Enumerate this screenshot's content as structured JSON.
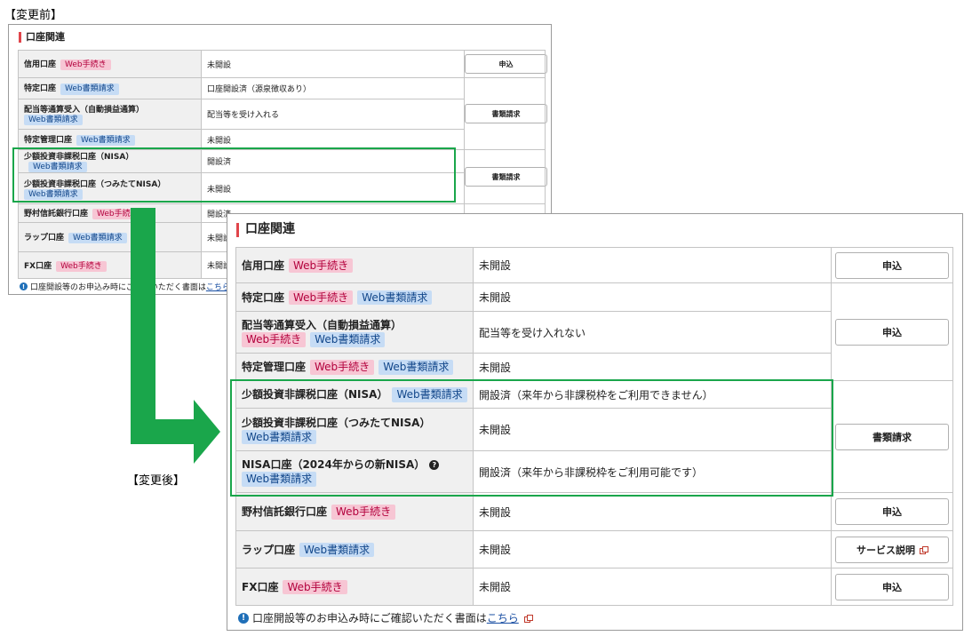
{
  "labels": {
    "before": "【変更前】",
    "after": "【変更後】"
  },
  "tags": {
    "web": "Web手続き",
    "doc": "Web書類請求"
  },
  "before": {
    "title": "口座関連",
    "rows": [
      {
        "label": "信用口座",
        "value": "未開設"
      },
      {
        "label": "特定口座",
        "value": "口座開設済（源泉徴収あり）"
      },
      {
        "label": "配当等通算受入（自動損益通算）",
        "value": "配当等を受け入れる"
      },
      {
        "label": "特定管理口座",
        "value": "未開設"
      },
      {
        "label": "少額投資非課税口座（NISA）",
        "value": "開設済"
      },
      {
        "label": "少額投資非課税口座（つみたてNISA）",
        "value": "未開設"
      },
      {
        "label": "野村信託銀行口座",
        "value": "開設済"
      },
      {
        "label": "ラップ口座",
        "value": "未開設"
      },
      {
        "label": "FX口座",
        "value": "未開設"
      }
    ],
    "buttons": {
      "apply": "申込",
      "docs": "書類請求"
    },
    "note": {
      "text": "口座開設等のお申込み時にご確認いただく書面は",
      "link": "こちら"
    }
  },
  "after": {
    "title": "口座関連",
    "rows": [
      {
        "label": "信用口座",
        "value": "未開設"
      },
      {
        "label": "特定口座",
        "value": "未開設"
      },
      {
        "label": "配当等通算受入（自動損益通算）",
        "value": "配当等を受け入れない"
      },
      {
        "label": "特定管理口座",
        "value": "未開設"
      },
      {
        "label": "少額投資非課税口座（NISA）",
        "value": "開設済（来年から非課税枠をご利用できません）"
      },
      {
        "label": "少額投資非課税口座（つみたてNISA）",
        "value": "未開設"
      },
      {
        "label": "NISA口座（2024年からの新NISA）",
        "value": "開設済（来年から非課税枠をご利用可能です）"
      },
      {
        "label": "野村信託銀行口座",
        "value": "未開設"
      },
      {
        "label": "ラップ口座",
        "value": "未開設"
      },
      {
        "label": "FX口座",
        "value": "未開設"
      }
    ],
    "buttons": {
      "apply": "申込",
      "docs": "書類請求",
      "service": "サービス説明"
    },
    "note": {
      "text": "口座開設等のお申込み時にご確認いただく書面は",
      "link": "こちら"
    }
  },
  "colors": {
    "highlight": "#1aa64b",
    "accent": "#e0454b",
    "web_tag": "#f7c6d4",
    "doc_tag": "#c6dcf5"
  }
}
